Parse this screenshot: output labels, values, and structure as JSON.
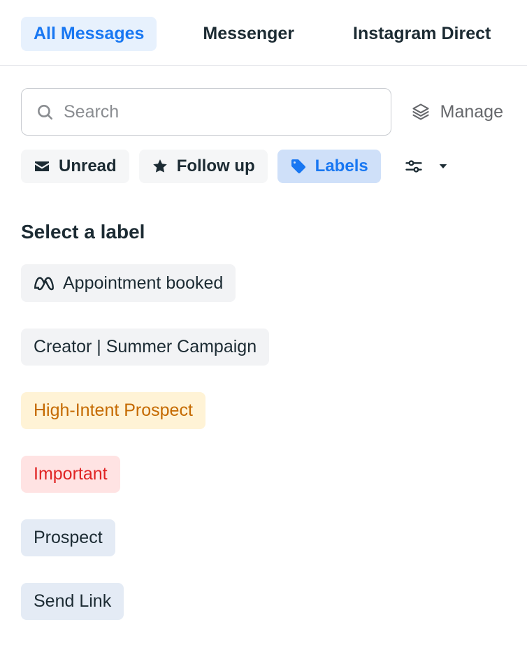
{
  "tabs": {
    "all": "All Messages",
    "messenger": "Messenger",
    "instagram": "Instagram Direct"
  },
  "search": {
    "placeholder": "Search"
  },
  "manage": {
    "label": "Manage"
  },
  "filters": {
    "unread": "Unread",
    "followup": "Follow up",
    "labels": "Labels"
  },
  "section": {
    "title": "Select a label"
  },
  "labels": {
    "appointment": "Appointment booked",
    "creator": "Creator | Summer Campaign",
    "high_intent": "High-Intent Prospect",
    "important": "Important",
    "prospect": "Prospect",
    "send_link": "Send Link"
  }
}
